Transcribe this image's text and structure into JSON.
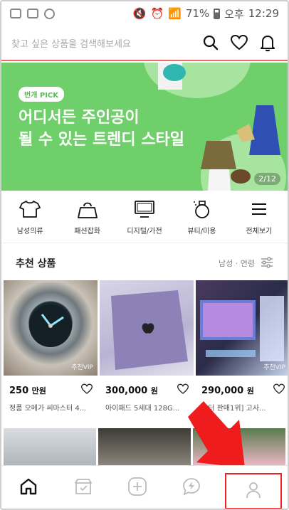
{
  "status_bar": {
    "signal_percent": "71%",
    "time_prefix": "오후",
    "time": "12:29"
  },
  "search": {
    "placeholder": "찾고 싶은 상품을 검색해보세요"
  },
  "banner": {
    "badge": "번개 PICK",
    "title_line1": "어디서든 주인공이",
    "title_line2": "될 수 있는 트렌디 스타일",
    "page_indicator": "2/12",
    "bg_color": "#6fcf6a"
  },
  "categories": [
    {
      "label": "남성의류",
      "icon": "tshirt-icon"
    },
    {
      "label": "패션잡화",
      "icon": "bag-icon"
    },
    {
      "label": "디지털/가전",
      "icon": "monitor-icon"
    },
    {
      "label": "뷰티/미용",
      "icon": "perfume-icon"
    },
    {
      "label": "전체보기",
      "icon": "menu-icon"
    }
  ],
  "recommend": {
    "title": "추천 상품",
    "filter_label": "남성 · 연령"
  },
  "products": [
    {
      "price": "250",
      "unit": "만원",
      "name": "정품 오메가 씨마스터 4...",
      "vip": "추천VIP"
    },
    {
      "price": "300,000",
      "unit": "원",
      "name": "아이패드 5세대 128G...",
      "vip": ""
    },
    {
      "price": "290,000",
      "unit": "원",
      "name": "포터 판매1위] 고사...",
      "vip": "추천VIP"
    }
  ],
  "nav": [
    {
      "name": "home",
      "icon": "home-icon"
    },
    {
      "name": "shop",
      "icon": "shop-check-icon"
    },
    {
      "name": "register",
      "icon": "plus-circle-icon"
    },
    {
      "name": "talk",
      "icon": "chat-lightning-icon"
    },
    {
      "name": "my",
      "icon": "user-icon"
    }
  ],
  "colors": {
    "accent_red": "#f06a6a",
    "highlight_red": "#e22222"
  }
}
